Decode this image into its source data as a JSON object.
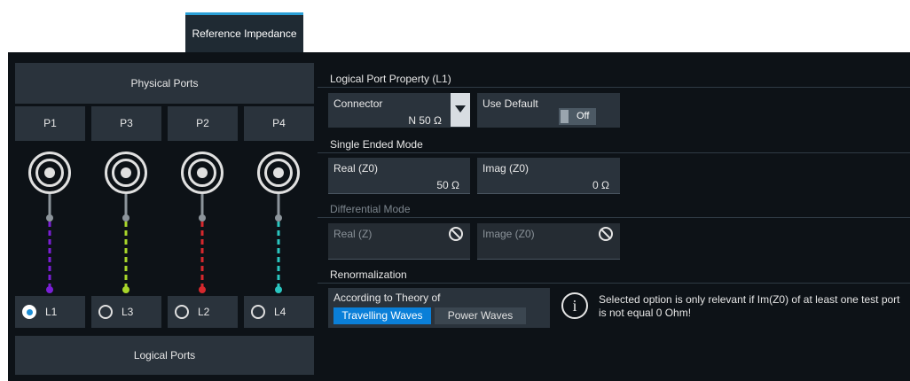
{
  "tab": {
    "label": "Reference Impedance"
  },
  "physical": {
    "title": "Physical Ports",
    "ports": [
      "P1",
      "P3",
      "P2",
      "P4"
    ]
  },
  "logical": {
    "title": "Logical Ports",
    "ports": [
      {
        "label": "L1",
        "selected": true
      },
      {
        "label": "L3",
        "selected": false
      },
      {
        "label": "L2",
        "selected": false
      },
      {
        "label": "L4",
        "selected": false
      }
    ],
    "wire_colors": [
      "#7a1fd6",
      "#a8d62a",
      "#d6282d",
      "#2ac6c0"
    ]
  },
  "property": {
    "title": "Logical Port Property (L1)",
    "connector_label": "Connector",
    "connector_value": "N 50 Ω",
    "use_default_label": "Use Default",
    "use_default_value": "Off"
  },
  "single_ended": {
    "title": "Single Ended Mode",
    "real_label": "Real (Z0)",
    "real_value": "50 Ω",
    "imag_label": "Imag (Z0)",
    "imag_value": "0 Ω"
  },
  "differential": {
    "title": "Differential Mode",
    "real_label": "Real (Z)",
    "imag_label": "Image (Z0)"
  },
  "renorm": {
    "title": "Renormalization",
    "theory_label": "According to Theory of",
    "option_travelling": "Travelling Waves",
    "option_power": "Power Waves",
    "selected": "Travelling Waves",
    "info_text": "Selected option is only relevant if Im(Z0) of at least one test port is not equal 0 Ohm!"
  },
  "colors": {
    "accent": "#0a7fd8",
    "panel": "#0d1217",
    "box": "#2a333c"
  }
}
